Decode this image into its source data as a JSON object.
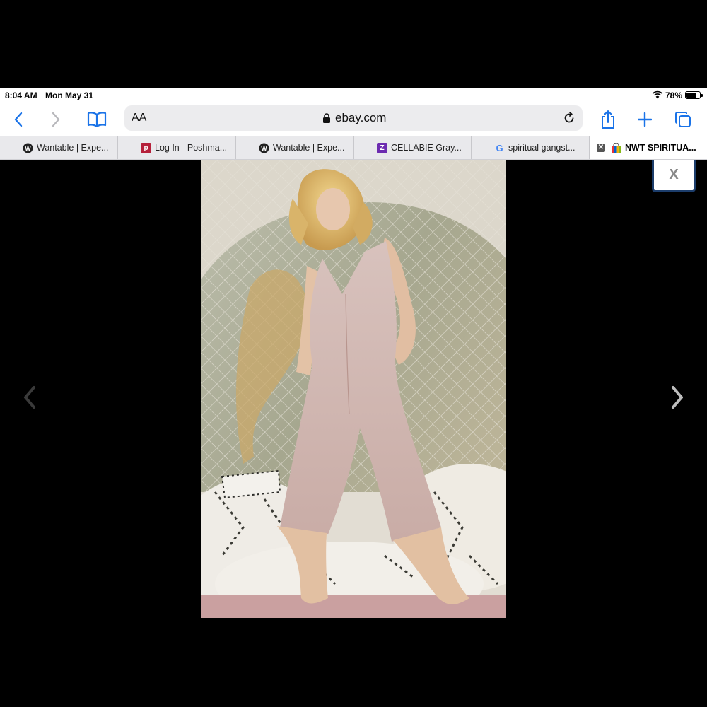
{
  "status_bar": {
    "time": "8:04 AM",
    "date": "Mon May 31",
    "battery": "78%",
    "battery_level": 0.78,
    "icons": [
      "wifi-icon",
      "battery-icon"
    ]
  },
  "toolbar": {
    "reader_label": "AA",
    "url": "ebay.com",
    "icons": [
      "back-icon",
      "forward-icon",
      "bookmarks-icon",
      "lock-icon",
      "reload-icon",
      "share-icon",
      "new-tab-icon",
      "tabs-overview-icon"
    ],
    "accent": "#1a73e8"
  },
  "tabs": [
    {
      "label": "Wantable | Expe...",
      "icon": "wantable-icon"
    },
    {
      "label": "Log In - Poshma...",
      "icon": "poshmark-icon"
    },
    {
      "label": "Wantable | Expe...",
      "icon": "wantable-icon"
    },
    {
      "label": "CELLABIE Gray...",
      "icon": "zulily-icon"
    },
    {
      "label": "spiritual gangst...",
      "icon": "google-icon"
    },
    {
      "label": "NWT SPIRITUA...",
      "icon": "ebay-icon",
      "active": true
    }
  ],
  "viewer": {
    "close_label": "X",
    "image_description_icon": "product-photo",
    "icons": [
      "prev-arrow-icon",
      "next-arrow-icon"
    ]
  }
}
